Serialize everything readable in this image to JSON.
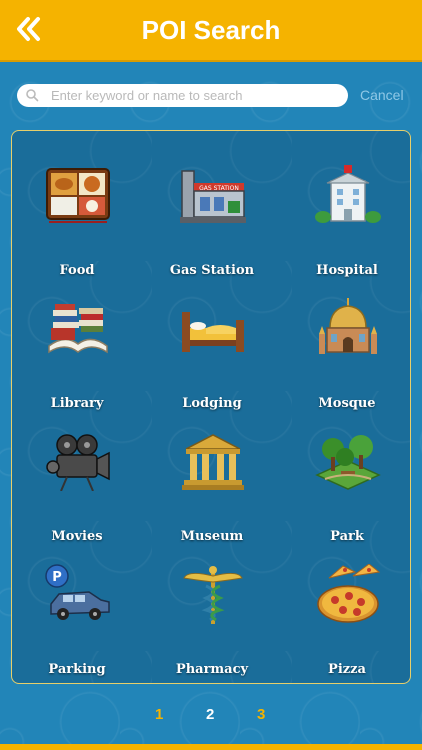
{
  "header": {
    "back_icon": "double-chevron-left-icon",
    "title": "POI Search"
  },
  "search": {
    "placeholder": "Enter keyword or name to search",
    "value": "",
    "cancel_label": "Cancel"
  },
  "categories": [
    {
      "label": "Food",
      "icon": "bento-food-icon"
    },
    {
      "label": "Gas Station",
      "icon": "gas-station-icon"
    },
    {
      "label": "Hospital",
      "icon": "hospital-icon"
    },
    {
      "label": "Library",
      "icon": "books-icon"
    },
    {
      "label": "Lodging",
      "icon": "bed-icon"
    },
    {
      "label": "Mosque",
      "icon": "mosque-icon"
    },
    {
      "label": "Movies",
      "icon": "film-camera-icon"
    },
    {
      "label": "Museum",
      "icon": "museum-icon"
    },
    {
      "label": "Park",
      "icon": "park-trees-icon"
    },
    {
      "label": "Parking",
      "icon": "parking-car-icon"
    },
    {
      "label": "Pharmacy",
      "icon": "caduceus-icon"
    },
    {
      "label": "Pizza",
      "icon": "pizza-icon"
    }
  ],
  "pagination": {
    "pages": [
      "1",
      "2",
      "3"
    ],
    "current": "2"
  },
  "colors": {
    "accent": "#f5b300",
    "background": "#1e7fb0",
    "panel_border": "#e7cf6a"
  }
}
